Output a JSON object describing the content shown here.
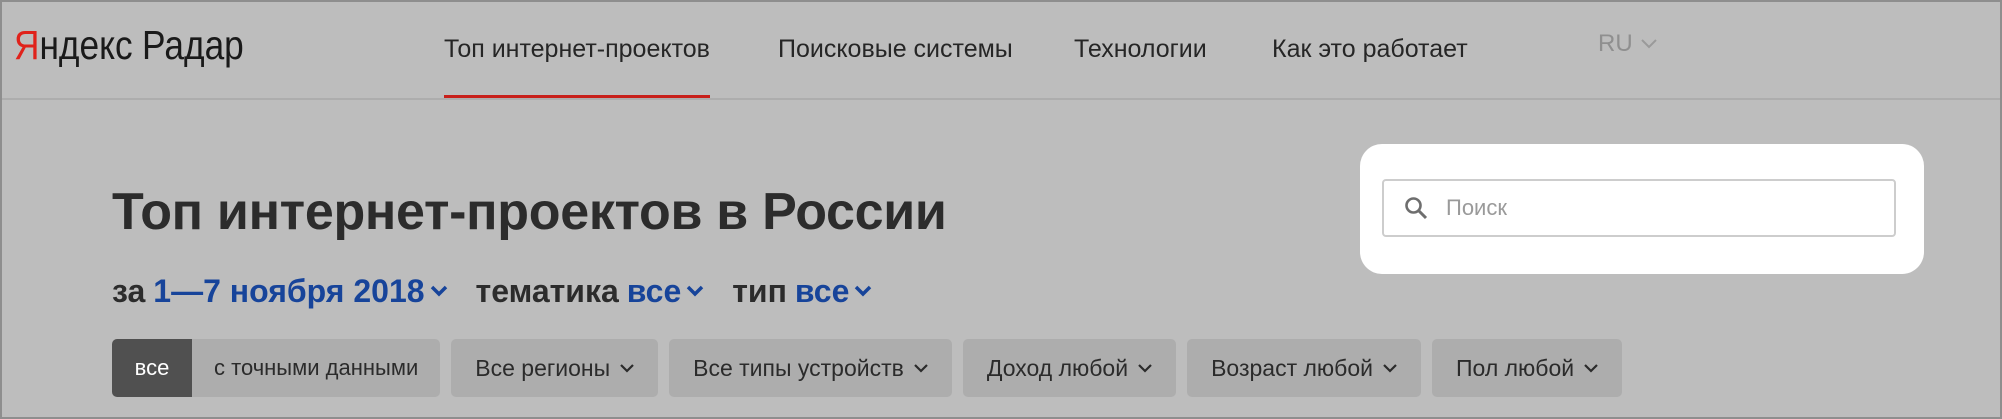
{
  "header": {
    "logo": {
      "brand_first": "Я",
      "brand_rest": "ндекс",
      "product": "Радар"
    },
    "nav": [
      {
        "label": "Топ интернет-проектов",
        "active": true
      },
      {
        "label": "Поисковые системы",
        "active": false
      },
      {
        "label": "Технологии",
        "active": false
      },
      {
        "label": "Как это работает",
        "active": false
      }
    ],
    "lang": "RU"
  },
  "page": {
    "title": "Топ интернет-проектов в России",
    "filters": {
      "period_label": "за",
      "period_value": "1—7 ноября 2018",
      "topic_label": "тематика",
      "topic_value": "все",
      "type_label": "тип",
      "type_value": "все"
    }
  },
  "search": {
    "placeholder": "Поиск",
    "value": ""
  },
  "chips": {
    "segment": {
      "all": "все",
      "exact": "с точными данными",
      "selected": "все"
    },
    "regions": "Все регионы",
    "devices": "Все типы устройств",
    "income": "Доход любой",
    "age": "Возраст любой",
    "gender": "Пол любой"
  },
  "colors": {
    "accent_red": "#c8201b",
    "link_blue": "#17449a",
    "background": "#bdbdbd",
    "chip": "#adadad",
    "segment_selected": "#505050"
  },
  "icons": [
    "search-icon",
    "chevron-down-icon"
  ]
}
